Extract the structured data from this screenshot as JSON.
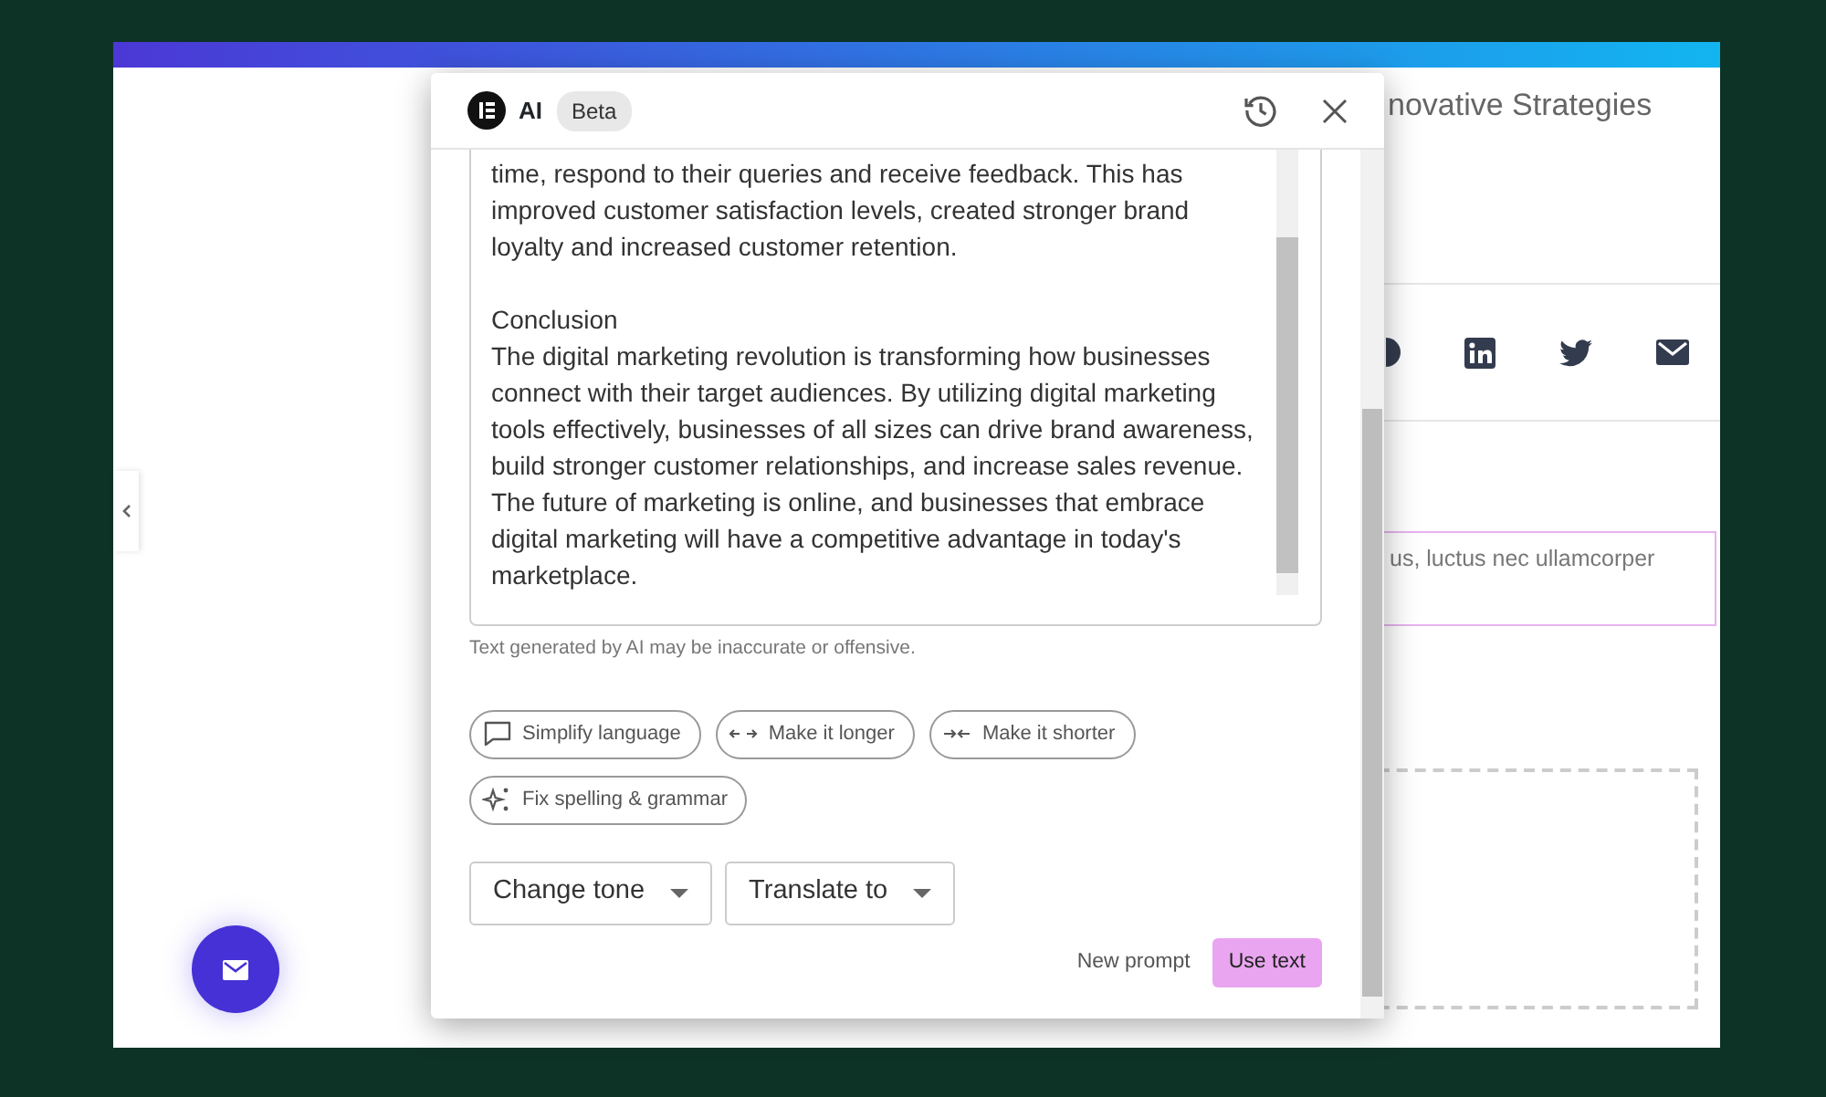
{
  "page": {
    "heading": "novative Strategies",
    "field_text": "us, luctus nec ullamcorper"
  },
  "dialog": {
    "logo_label": "AI",
    "badge": "Beta",
    "paragraphs": [
      "time, respond to their queries and receive feedback. This has improved customer satisfaction levels, created stronger brand loyalty and increased customer retention.",
      "Conclusion",
      "The digital marketing revolution is transforming how businesses connect with their target audiences. By utilizing digital marketing tools effectively, businesses of all sizes can drive brand awareness, build stronger customer relationships, and increase sales revenue. The future of marketing is online, and businesses that embrace digital marketing will have a competitive advantage in today's marketplace."
    ],
    "disclaimer": "Text generated by AI may be inaccurate or offensive.",
    "chips": [
      {
        "kind": "chat",
        "label": "Simplify language"
      },
      {
        "kind": "expand",
        "label": "Make it longer"
      },
      {
        "kind": "shrink",
        "label": "Make it shorter"
      },
      {
        "kind": "sparkle",
        "label": "Fix spelling & grammar"
      }
    ],
    "dropdowns": [
      "Change tone",
      "Translate to"
    ],
    "secondary_action": "New prompt",
    "primary_action": "Use text"
  }
}
